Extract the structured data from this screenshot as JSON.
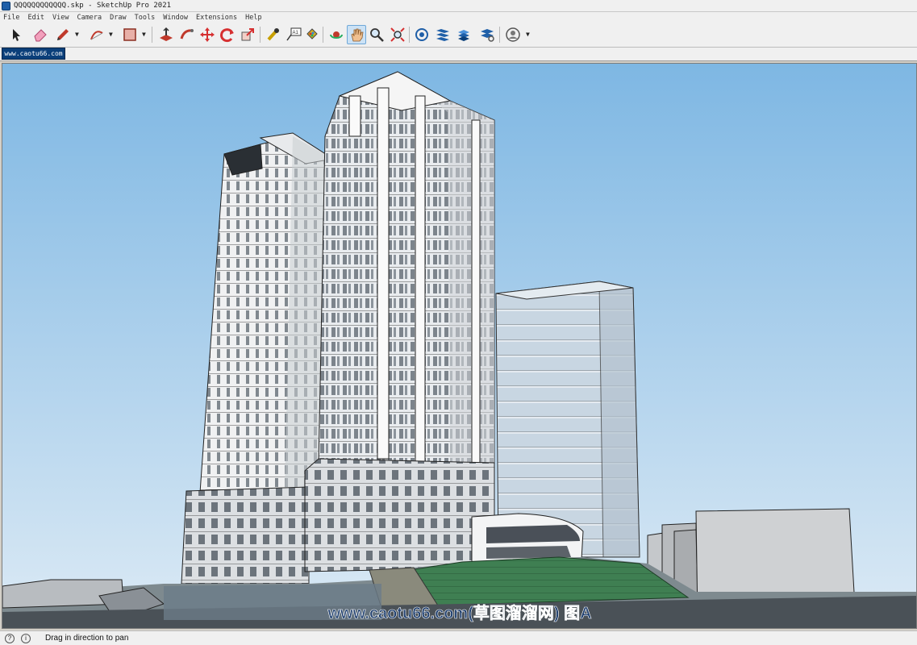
{
  "window": {
    "title": "QQQQQQQQQQQQ.skp - SketchUp Pro 2021"
  },
  "menu": [
    "File",
    "Edit",
    "View",
    "Camera",
    "Draw",
    "Tools",
    "Window",
    "Extensions",
    "Help"
  ],
  "toolbar": {
    "tools": [
      {
        "name": "select-tool-icon",
        "color": "#222222"
      },
      {
        "name": "eraser-tool-icon",
        "color": "#e0608a"
      },
      {
        "name": "pencil-line-tool-icon",
        "color": "#c0392b"
      },
      {
        "name": "arc-tool-icon",
        "color": "#c0392b"
      },
      {
        "name": "rectangle-tool-icon",
        "color": "#c0392b"
      },
      {
        "name": "push-pull-tool-icon",
        "color": "#c0392b"
      },
      {
        "name": "follow-me-tool-icon",
        "color": "#c0392b"
      },
      {
        "name": "move-tool-icon",
        "color": "#d63031"
      },
      {
        "name": "rotate-tool-icon",
        "color": "#d63031"
      },
      {
        "name": "scale-tool-icon",
        "color": "#d63031"
      },
      {
        "name": "tape-measure-tool-icon",
        "color": "#c8a000"
      },
      {
        "name": "text-tool-icon",
        "color": "#333333"
      },
      {
        "name": "paint-bucket-tool-icon",
        "color": "#c8a000"
      },
      {
        "name": "orbit-tool-icon",
        "color": "#d63031"
      },
      {
        "name": "pan-tool-icon",
        "color": "#e0a060"
      },
      {
        "name": "zoom-tool-icon",
        "color": "#1f5fa8"
      },
      {
        "name": "zoom-extents-tool-icon",
        "color": "#d63031"
      },
      {
        "name": "3d-warehouse-icon",
        "color": "#1f5fa8"
      },
      {
        "name": "extension-warehouse-icon",
        "color": "#1f5fa8"
      },
      {
        "name": "layout-icon",
        "color": "#1f5fa8"
      },
      {
        "name": "extension-manager-icon",
        "color": "#1f5fa8"
      },
      {
        "name": "account-icon",
        "color": "#555555"
      }
    ],
    "active_tool": "pan-tool-icon"
  },
  "scene_tab": {
    "label": "www.caotu66.com"
  },
  "viewport": {
    "watermark": "www.caotu66.com(草图溜溜网) 图A",
    "sky_top": "#7eb7e3",
    "sky_bottom": "#dceaf5"
  },
  "statusbar": {
    "icons": [
      "help-icon",
      "info-icon"
    ],
    "message": "Drag in direction to pan"
  }
}
